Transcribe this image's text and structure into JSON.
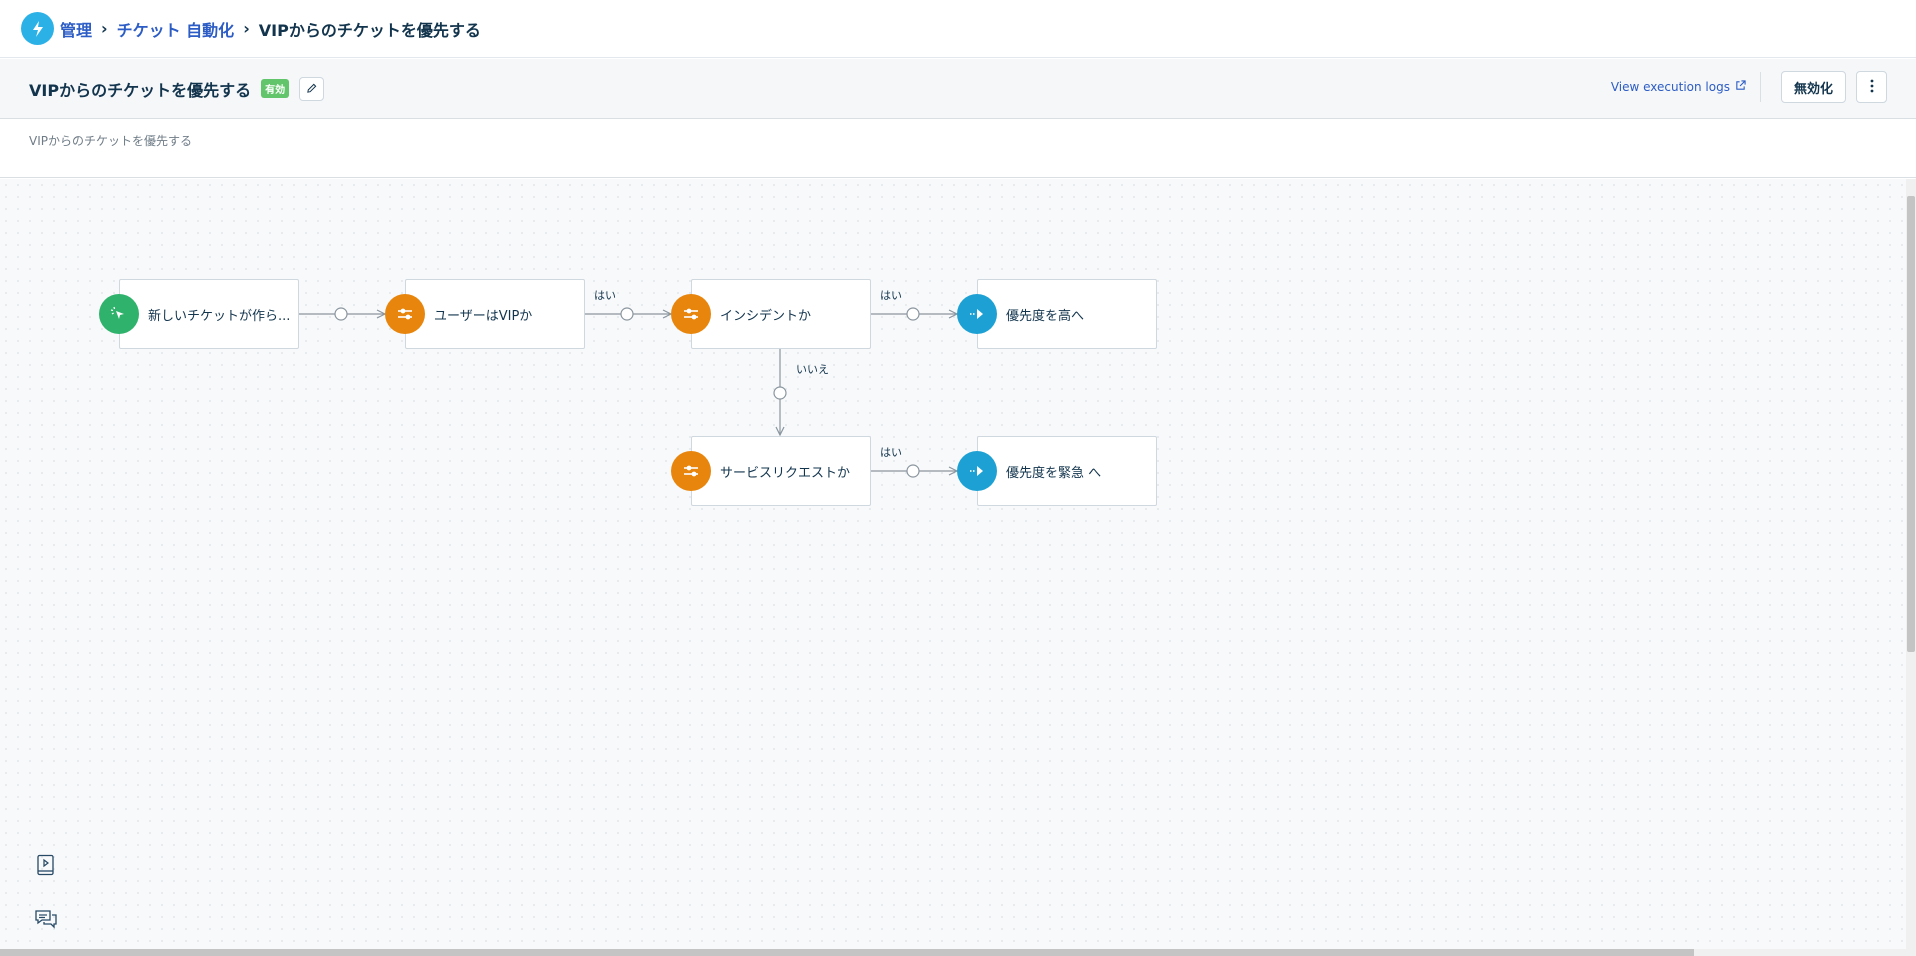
{
  "breadcrumb": {
    "root": "管理",
    "section": "チケット 自動化",
    "current": "VIPからのチケットを優先する"
  },
  "header": {
    "title": "VIPからのチケットを優先する",
    "status_badge": "有効",
    "exec_logs": "View execution logs",
    "disable_button": "無効化"
  },
  "description": "VIPからのチケットを優先する",
  "flow": {
    "nodes": [
      {
        "id": "trigger",
        "label": "新しいチケットが作ら...",
        "kind": "trigger"
      },
      {
        "id": "cond-vip",
        "label": "ユーザーはVIPか",
        "kind": "condition"
      },
      {
        "id": "cond-incident",
        "label": "インシデントか",
        "kind": "condition"
      },
      {
        "id": "act-high",
        "label": "優先度を高へ",
        "kind": "action"
      },
      {
        "id": "cond-sr",
        "label": "サービスリクエストか",
        "kind": "condition"
      },
      {
        "id": "act-urgent",
        "label": "優先度を緊急 へ",
        "kind": "action"
      }
    ],
    "edge_labels": {
      "yes": "はい",
      "no": "いいえ"
    }
  },
  "colors": {
    "trigger": "#2fb26b",
    "condition": "#e8850c",
    "action": "#1da1d4",
    "link": "#2c5cc5",
    "badge": "#62c56b"
  },
  "icons": {
    "logo": "lightning-icon",
    "edit": "pencil-icon",
    "external": "external-link-icon",
    "more": "kebab-icon",
    "playbook": "playbook-icon",
    "chat": "chat-icon"
  }
}
